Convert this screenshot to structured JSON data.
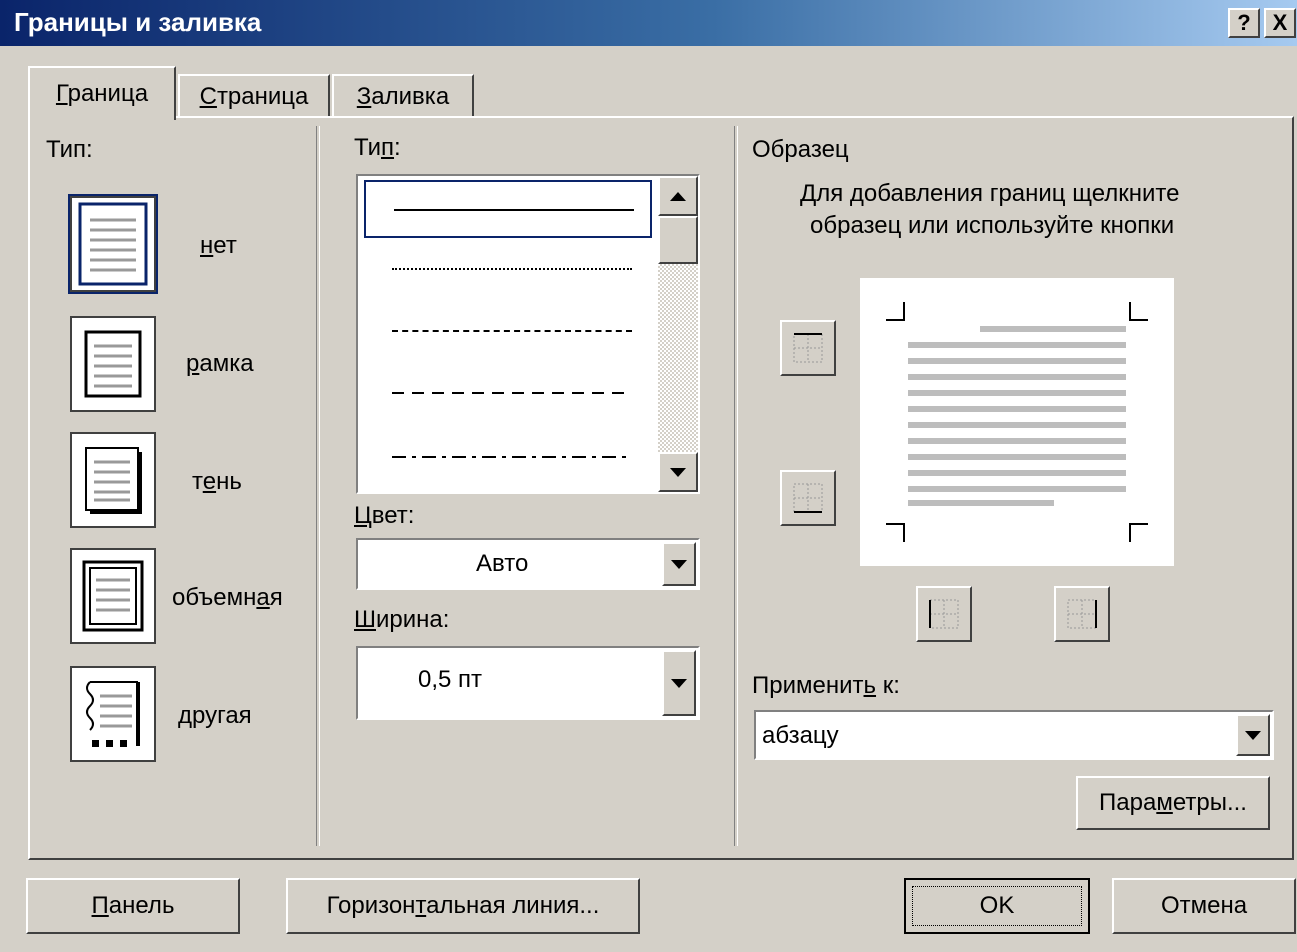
{
  "window": {
    "title": "Границы и заливка",
    "help_button": "?",
    "close_button": "X"
  },
  "tabs": [
    {
      "label": "Граница",
      "mnemonic": "Г",
      "rest": "раница",
      "active": true
    },
    {
      "label": "Страница",
      "mnemonic": "С",
      "rest": "траница",
      "active": false
    },
    {
      "label": "Заливка",
      "mnemonic": "З",
      "rest": "аливка",
      "active": false
    }
  ],
  "setting": {
    "label": "Тип:",
    "options": [
      {
        "pre": "",
        "mnemonic": "н",
        "post": "ет",
        "label": "нет",
        "icon": "border-none-icon",
        "selected": true
      },
      {
        "pre": "",
        "mnemonic": "р",
        "post": "амка",
        "label": "рамка",
        "icon": "border-box-icon",
        "selected": false
      },
      {
        "pre": "т",
        "mnemonic": "е",
        "post": "нь",
        "label": "тень",
        "icon": "border-shadow-icon",
        "selected": false
      },
      {
        "pre": "объемн",
        "mnemonic": "а",
        "post": "я",
        "label": "объемная",
        "icon": "border-3d-icon",
        "selected": false
      },
      {
        "pre": "",
        "mnemonic": "д",
        "post": "ругая",
        "label": "другая",
        "icon": "border-custom-icon",
        "selected": false
      }
    ]
  },
  "style": {
    "label_pre": "Ти",
    "label_mnemonic": "п",
    "label_post": ":",
    "label": "Тип:",
    "line_styles": [
      "solid",
      "dotted",
      "dashed-small",
      "dashed",
      "dash-dot"
    ]
  },
  "color": {
    "label_mnemonic": "Ц",
    "label_post": "вет:",
    "label": "Цвет:",
    "value": "Авто"
  },
  "width": {
    "label_mnemonic": "Ш",
    "label_post": "ирина:",
    "label": "Ширина:",
    "value": "0,5 пт"
  },
  "preview": {
    "label": "Образец",
    "hint_line1": "Для добавления границ щелкните",
    "hint_line2": "образец или используйте кнопки",
    "buttons": [
      "top-border-icon",
      "bottom-border-icon",
      "left-border-icon",
      "right-border-icon"
    ]
  },
  "apply_to": {
    "label_pre": "Применит",
    "label_mnemonic": "ь",
    "label_post": " к:",
    "label": "Применить к:",
    "value": "абзацу"
  },
  "params_button": {
    "pre": "Пара",
    "mnemonic": "м",
    "post": "етры...",
    "label": "Параметры..."
  },
  "footer": {
    "panel_button": {
      "pre": "",
      "mnemonic": "П",
      "post": "анель",
      "label": "Панель"
    },
    "hline_button": {
      "pre": "Горизон",
      "mnemonic": "т",
      "post": "альная линия...",
      "label": "Горизонтальная линия..."
    },
    "ok_button": "OK",
    "cancel_button": "Отмена"
  },
  "colors": {
    "dialog_bg": "#d4d0c8",
    "title_start": "#0a246a",
    "title_end": "#a6caf0",
    "selection": "#0a246a"
  }
}
